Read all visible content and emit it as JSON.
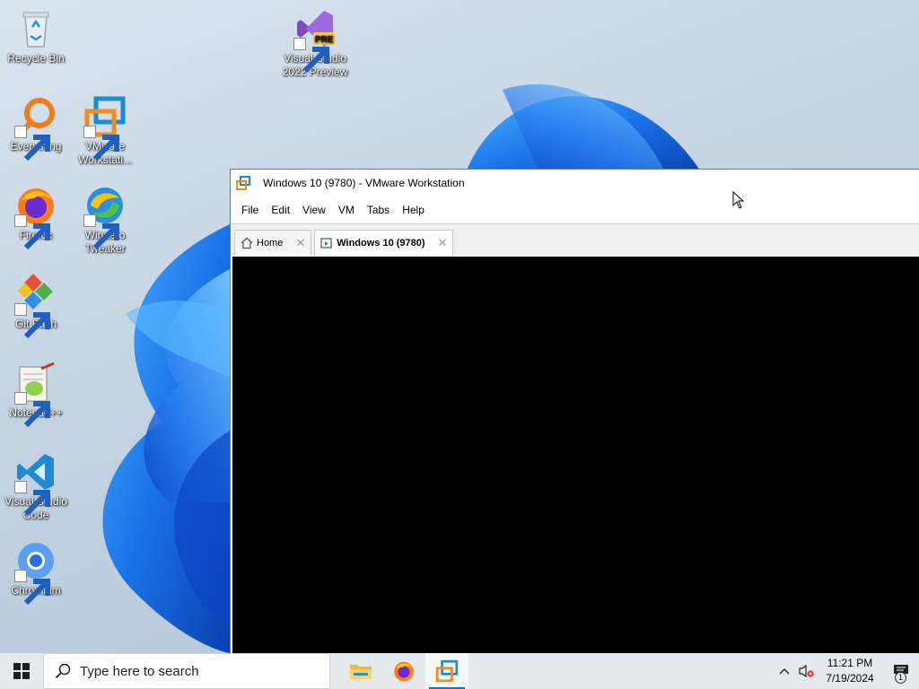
{
  "desktop": {
    "icons": [
      {
        "label": "Recycle Bin",
        "icon": "recycle-bin-icon"
      },
      {
        "label": "Visual Studio 2022 Preview",
        "icon": "visual-studio-preview-icon",
        "badge": "PRE"
      },
      {
        "label": "Everything",
        "icon": "everything-search-icon"
      },
      {
        "label": "VMware Workstati...",
        "icon": "vmware-icon"
      },
      {
        "label": "Firefox",
        "icon": "firefox-icon"
      },
      {
        "label": "Winaero Tweaker",
        "icon": "winaero-tweaker-icon"
      },
      {
        "label": "Git Bash",
        "icon": "git-bash-icon"
      },
      {
        "label": "Notepad++",
        "icon": "notepad-plus-plus-icon"
      },
      {
        "label": "Visual Studio Code",
        "icon": "vscode-icon"
      },
      {
        "label": "Chromium",
        "icon": "chromium-icon"
      }
    ]
  },
  "vmware": {
    "title": "Windows 10 (9780) - VMware Workstation",
    "menu": [
      "File",
      "Edit",
      "View",
      "VM",
      "Tabs",
      "Help"
    ],
    "tabs": [
      {
        "label": "Home",
        "icon": "home-icon",
        "active": false
      },
      {
        "label": "Windows 10 (9780)",
        "icon": "vm-tab-icon",
        "active": true
      }
    ]
  },
  "taskbar": {
    "search_placeholder": "Type here to search",
    "apps": [
      "file-explorer-icon",
      "firefox-icon",
      "vmware-icon"
    ],
    "clock_time": "11:21 PM",
    "clock_date": "7/19/2024",
    "notification_count": "1"
  },
  "colors": {
    "accent": "#0078d4",
    "taskbar_bg": "#e6eaee",
    "vm_screen": "#000000"
  }
}
